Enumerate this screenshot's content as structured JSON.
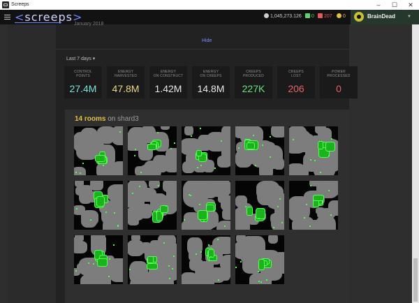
{
  "window": {
    "title": "Screeps",
    "controls": [
      "–",
      "☐",
      "✕"
    ]
  },
  "header": {
    "logo": "screeps",
    "resources": [
      {
        "icon": "credits-icon",
        "value": "1,045,273.126",
        "color": "#cfcfcf"
      },
      {
        "icon": "cpu-icon",
        "value": "0",
        "color": "#5fd36b"
      },
      {
        "icon": "bucket-icon",
        "value": "207",
        "color": "#e25b5b"
      },
      {
        "icon": "gcl-icon",
        "value": "0",
        "color": "#e2c13b"
      }
    ],
    "user": {
      "name": "BrainDead",
      "avatar_color": "#c9c22d"
    }
  },
  "overview": {
    "date_text": "January 2018",
    "hide_label": "Hide",
    "range_label": "Last 7 days ▾",
    "stats": [
      {
        "label_lines": [
          "CONTROL",
          "POINTS"
        ],
        "value": "27.4M",
        "color": "#7de2dd"
      },
      {
        "label_lines": [
          "ENERGY",
          "HARVESTED"
        ],
        "value": "47.8M",
        "color": "#e8d88a"
      },
      {
        "label_lines": [
          "ENERGY",
          "ON CONSTRUCT"
        ],
        "value": "1.42M",
        "color": "#e8e8e8"
      },
      {
        "label_lines": [
          "ENERGY",
          "ON CREEPS"
        ],
        "value": "14.8M",
        "color": "#e8e8e8"
      },
      {
        "label_lines": [
          "CREEPS",
          "PRODUCED"
        ],
        "value": "227K",
        "color": "#6ae27d"
      },
      {
        "label_lines": [
          "CREEPS",
          "LOST"
        ],
        "value": "206",
        "color": "#e36464"
      },
      {
        "label_lines": [
          "POWER",
          "PROCESSED"
        ],
        "value": "0",
        "color": "#e36464"
      }
    ]
  },
  "rooms": {
    "count_label": "14 rooms",
    "on_label": " on ",
    "shard": "shard3",
    "room_count": 14
  },
  "colors": {
    "accent": "#6f86ff",
    "room_wall": "#7d7d7d",
    "room_structures": "#1bb31b",
    "background": "#222222"
  }
}
